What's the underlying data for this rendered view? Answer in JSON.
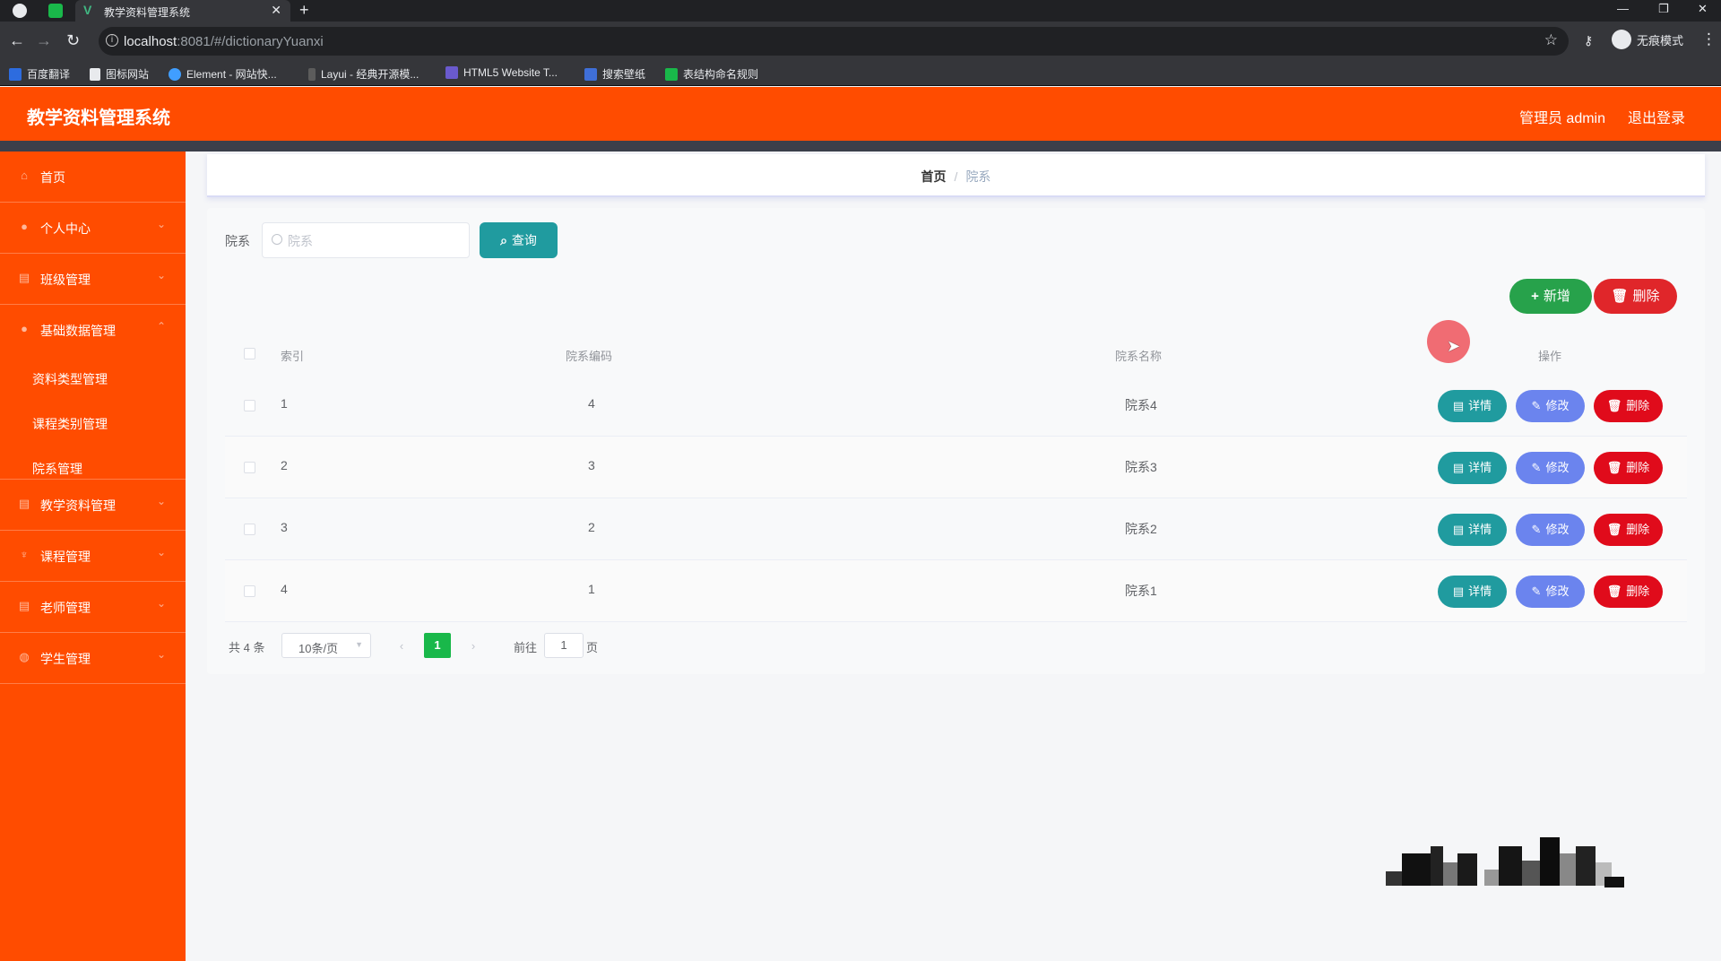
{
  "browser": {
    "tab_title": "教学资料管理系统",
    "url_host": "localhost",
    "url_rest": ":8081/#/dictionaryYuanxi",
    "incognito_label": "无痕模式",
    "bookmarks": [
      "百度翻译",
      "图标网站",
      "Element - 网站快...",
      "Layui - 经典开源模...",
      "HTML5 Website T...",
      "搜索壁纸",
      "表结构命名规则"
    ]
  },
  "header": {
    "app_title": "教学资料管理系统",
    "user_label": "管理员 admin",
    "logout_label": "退出登录"
  },
  "sidebar": {
    "items": [
      {
        "label": "首页",
        "icon": "home-icon"
      },
      {
        "label": "个人中心",
        "icon": "user-icon"
      },
      {
        "label": "班级管理",
        "icon": "grid-icon"
      },
      {
        "label": "基础数据管理",
        "icon": "user-icon"
      },
      {
        "label": "教学资料管理",
        "icon": "grid-icon"
      },
      {
        "label": "课程管理",
        "icon": "medal-icon"
      },
      {
        "label": "老师管理",
        "icon": "grid-icon"
      },
      {
        "label": "学生管理",
        "icon": "globe-icon"
      }
    ],
    "sub_items": [
      "资料类型管理",
      "课程类别管理",
      "院系管理"
    ]
  },
  "breadcrumb": {
    "home": "首页",
    "separator": "/",
    "current": "院系"
  },
  "search": {
    "label": "院系",
    "placeholder": "院系",
    "query_button": "查询"
  },
  "actions": {
    "add_button": "新增",
    "delete_button": "删除"
  },
  "table": {
    "columns": [
      "索引",
      "院系编码",
      "院系名称",
      "操作"
    ],
    "rows": [
      {
        "index": "1",
        "code": "4",
        "name": "院系4"
      },
      {
        "index": "2",
        "code": "3",
        "name": "院系3"
      },
      {
        "index": "3",
        "code": "2",
        "name": "院系2"
      },
      {
        "index": "4",
        "code": "1",
        "name": "院系1"
      }
    ],
    "row_buttons": {
      "detail": "详情",
      "edit": "修改",
      "delete": "删除"
    }
  },
  "pagination": {
    "total_text": "共 4 条",
    "page_size": "10条/页",
    "current_page": "1",
    "goto_label": "前往",
    "goto_value": "1",
    "page_suffix": "页"
  },
  "colors": {
    "brand": "#ff4c00",
    "query": "#209b9f",
    "add": "#27a24b",
    "danger": "#e00b1b",
    "edit": "#6b84ee",
    "pager_active": "#19b84a"
  }
}
